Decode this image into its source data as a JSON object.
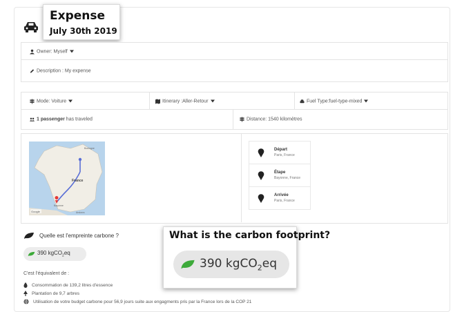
{
  "header": {
    "title": "Expense",
    "date": "July 30th 2019"
  },
  "owner_row": {
    "label": "Owner: Myself"
  },
  "description_row": {
    "label": "Description : My expense"
  },
  "trip": {
    "mode": "Mode: Voiture",
    "itinerary": "Itinerary :Aller-Retour",
    "fuel": "Fuel Type:fuel-type-mixed",
    "passengers_bold": "1 passenger",
    "passengers_rest": " has traveled",
    "distance": "Distance: 1540 kilomètres"
  },
  "map": {
    "country_label": "France",
    "city_top": "Boulogne",
    "city_left": "Bayonne",
    "city_bottom": "Andorra"
  },
  "stops": [
    {
      "name": "Départ",
      "place": "Paris, France"
    },
    {
      "name": "Étape",
      "place": "Bayonne, France"
    },
    {
      "name": "Arrivée",
      "place": "Paris, France"
    }
  ],
  "carbon": {
    "question": "Quelle est l'empreinte carbone ?",
    "value": "390 kgCO",
    "subscript": "2",
    "unit_suffix": "eq"
  },
  "callout": {
    "question": "What is the carbon footprint?",
    "value": "390 kgCO",
    "subscript": "2",
    "unit_suffix": "eq"
  },
  "equivalents": {
    "heading": "C'est l'équivalent de :",
    "items": [
      "Consommation de 139,2 litres d'essence",
      "Plantation de 9,7 arbres",
      "Utilisation de votre budget carbone pour 56,9 jours suite aux engagments pris par la France lors de la COP 21"
    ]
  },
  "colors": {
    "leaf_green": "#3daa3a",
    "pin_dark": "#222222",
    "route": "#5a6fd6",
    "end_pin": "#e53935"
  }
}
